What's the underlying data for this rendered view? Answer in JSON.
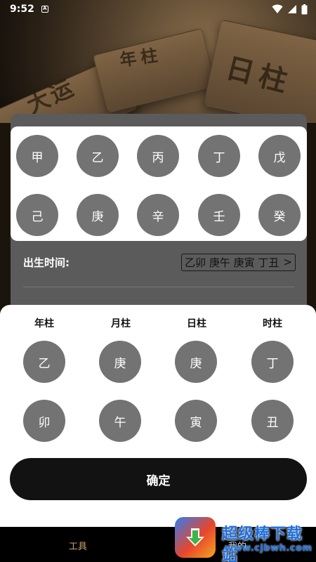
{
  "status_bar": {
    "time": "9:52",
    "notification_glyph": "A",
    "icons": [
      "wifi-icon",
      "signal-icon",
      "battery-icon"
    ]
  },
  "hero": {
    "carvings": [
      "大运",
      "年柱",
      "日柱"
    ]
  },
  "stem_picker": {
    "stems": [
      "甲",
      "乙",
      "丙",
      "丁",
      "戊",
      "己",
      "庚",
      "辛",
      "壬",
      "癸"
    ]
  },
  "birth_time": {
    "label": "出生时间:",
    "value": "乙卯 庚午 庚寅 丁丑",
    "chevron": ">"
  },
  "pillars": {
    "headers": [
      "年柱",
      "月柱",
      "日柱",
      "时柱"
    ],
    "stems": [
      "乙",
      "庚",
      "庚",
      "丁"
    ],
    "branches": [
      "卯",
      "午",
      "寅",
      "丑"
    ]
  },
  "confirm_label": "确定",
  "bottom_nav": {
    "items": [
      "工具",
      "我的"
    ]
  },
  "watermark": {
    "text": "超级棒下载站",
    "url": "www.cjbwh.com"
  },
  "colors": {
    "circle": "#737373",
    "confirm_bg": "#121212",
    "nav_active": "#c9a56b",
    "card_bg": "#5b5b5b"
  }
}
